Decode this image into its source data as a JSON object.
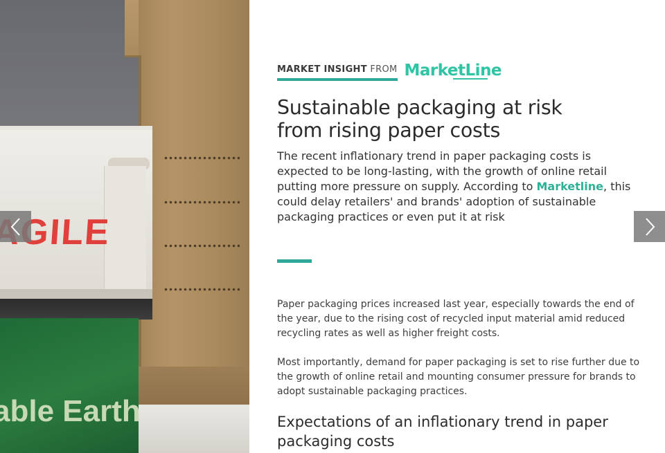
{
  "photo": {
    "box_text_fragile": "AGILE",
    "box_text_earth": "able Earth"
  },
  "nav": {
    "prev_icon": "chevron-left-icon",
    "next_icon": "chevron-right-icon"
  },
  "header": {
    "label_strong": "MARKET INSIGHT",
    "label_from": "FROM",
    "logo_text": "MarketLine"
  },
  "article": {
    "headline": "Sustainable packaging at risk from rising paper costs",
    "lede_part1": "The recent inflationary trend in paper packaging costs is expected to be long-lasting, with the growth of online retail putting more pressure on supply. According to ",
    "lede_brand": "Marketline",
    "lede_part2": ", this could delay retailers' and brands' adoption of sustainable packaging practices or even put it at risk",
    "paragraph_1": "Paper packaging prices increased last year, especially towards the end of the year, due to the rising cost of recycled input material amid reduced recycling rates as well as higher freight costs.",
    "paragraph_2": "Most importantly, demand for paper packaging is set to rise further due to the growth of online retail and mounting consumer pressure for brands to adopt sustainable packaging practices.",
    "subheading": "Expectations of an inflationary trend in paper packaging costs"
  },
  "colors": {
    "accent": "#2fa89a",
    "brand": "#2fc4a4",
    "text": "#333333"
  }
}
